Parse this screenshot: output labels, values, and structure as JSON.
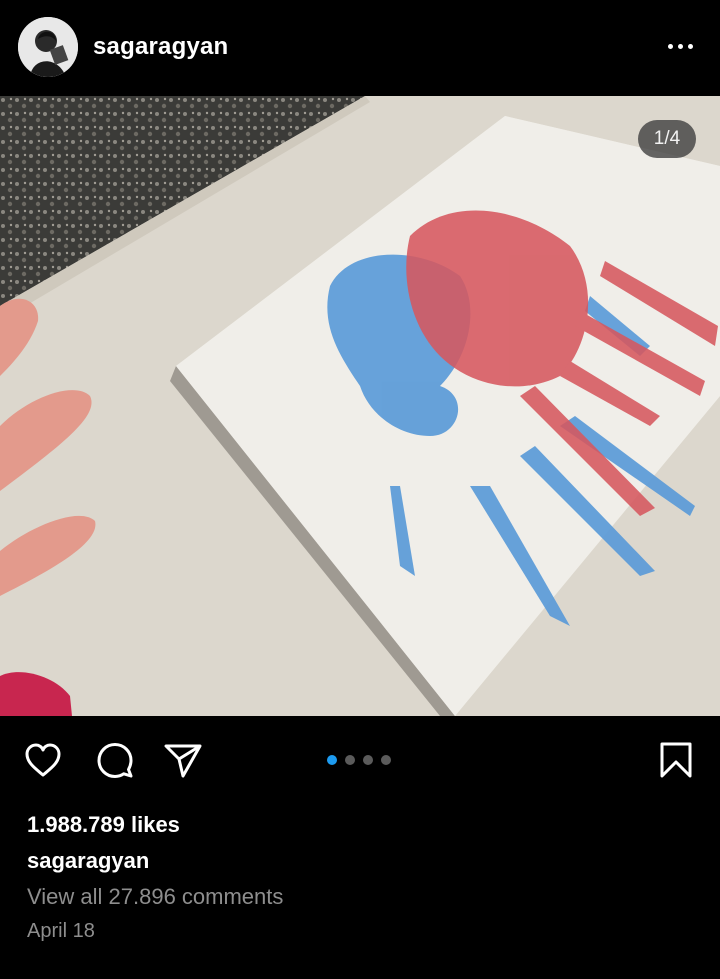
{
  "header": {
    "username": "sagaragyan",
    "more_icon": "more-horizontal-icon"
  },
  "post": {
    "image_counter": "1/4",
    "carousel": {
      "total": 4,
      "active_index": 0
    }
  },
  "actions": {
    "like_icon": "heart-icon",
    "comment_icon": "comment-bubble-icon",
    "share_icon": "paper-plane-icon",
    "save_icon": "bookmark-icon"
  },
  "meta": {
    "likes": "1.988.789 likes",
    "owner": "sagaragyan",
    "comments_link": "View all 27.896 comments",
    "date": "April 18"
  },
  "colors": {
    "background": "#000000",
    "accent_dot": "#1d9bf0",
    "muted_text": "#8e8e8e"
  }
}
